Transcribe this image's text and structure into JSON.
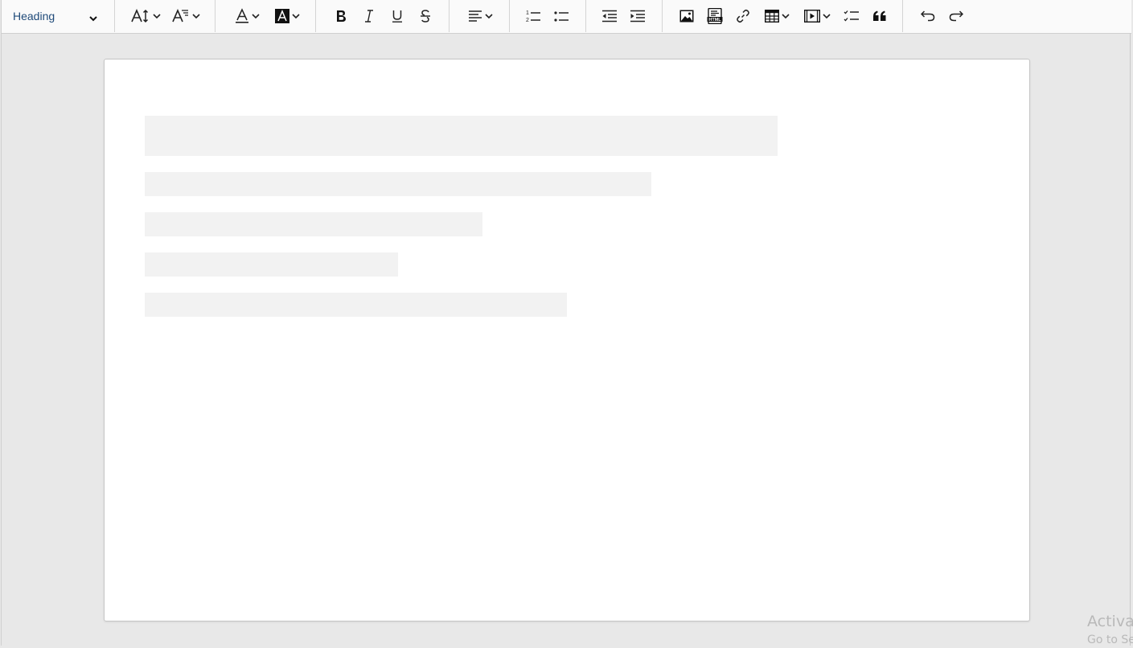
{
  "toolbar": {
    "heading_select": {
      "value": "Heading",
      "icon": "chevron-down-icon"
    },
    "groups": [
      {
        "name": "font",
        "items": [
          {
            "id": "font-size",
            "icon": "font-size-icon",
            "dropdown": true
          },
          {
            "id": "font-family",
            "icon": "font-family-icon",
            "dropdown": true
          }
        ]
      },
      {
        "name": "color",
        "items": [
          {
            "id": "font-color",
            "icon": "font-color-icon",
            "dropdown": true
          },
          {
            "id": "background-color",
            "icon": "background-color-icon",
            "dropdown": true
          }
        ]
      },
      {
        "name": "format",
        "items": [
          {
            "id": "bold",
            "icon": "bold-icon",
            "label": "B"
          },
          {
            "id": "italic",
            "icon": "italic-icon",
            "label": "I"
          },
          {
            "id": "underline",
            "icon": "underline-icon",
            "label": "U"
          },
          {
            "id": "strikethrough",
            "icon": "strikethrough-icon",
            "label": "S"
          }
        ]
      },
      {
        "name": "align",
        "items": [
          {
            "id": "alignment",
            "icon": "align-left-icon",
            "dropdown": true
          }
        ]
      },
      {
        "name": "lists",
        "items": [
          {
            "id": "numbered-list",
            "icon": "numbered-list-icon"
          },
          {
            "id": "bulleted-list",
            "icon": "bulleted-list-icon"
          }
        ]
      },
      {
        "name": "indent",
        "items": [
          {
            "id": "outdent",
            "icon": "outdent-icon"
          },
          {
            "id": "indent",
            "icon": "indent-icon"
          }
        ]
      },
      {
        "name": "insert",
        "items": [
          {
            "id": "insert-image",
            "icon": "image-icon"
          },
          {
            "id": "html-embed",
            "icon": "html-embed-icon",
            "label": "HTML"
          },
          {
            "id": "link",
            "icon": "link-icon"
          },
          {
            "id": "insert-table",
            "icon": "table-icon",
            "dropdown": true
          },
          {
            "id": "insert-media",
            "icon": "media-icon",
            "dropdown": true
          },
          {
            "id": "todo-list",
            "icon": "todo-list-icon"
          },
          {
            "id": "block-quote",
            "icon": "quote-icon"
          }
        ]
      },
      {
        "name": "history",
        "items": [
          {
            "id": "undo",
            "icon": "undo-icon"
          },
          {
            "id": "redo",
            "icon": "redo-icon"
          }
        ]
      }
    ]
  },
  "editor": {
    "state": "loading-skeleton",
    "skeleton_lines": 5
  },
  "watermark": {
    "title": "Activat",
    "subtitle": "Go to Se"
  }
}
